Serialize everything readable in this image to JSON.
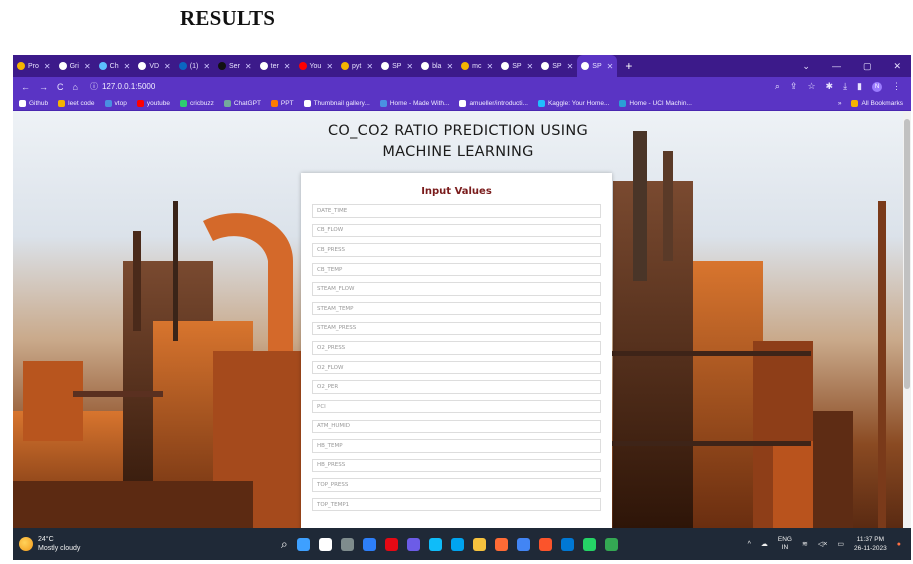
{
  "doc_heading": "RESULTS",
  "browser": {
    "tabs": [
      {
        "label": "Pro",
        "color": "#f5b400"
      },
      {
        "label": "Gri",
        "color": "#ffffff"
      },
      {
        "label": "Ch",
        "color": "#5cc0ff"
      },
      {
        "label": "VD",
        "color": "#ffffff"
      },
      {
        "label": "(1)",
        "color": "#0a66c2"
      },
      {
        "label": "Ser",
        "color": "#111111"
      },
      {
        "label": "ter",
        "color": "#ffffff"
      },
      {
        "label": "You",
        "color": "#ff0000"
      },
      {
        "label": "pyt",
        "color": "#f5b400"
      },
      {
        "label": "SP",
        "color": "#ffffff"
      },
      {
        "label": "bla",
        "color": "#ffffff"
      },
      {
        "label": "mc",
        "color": "#f5b400"
      },
      {
        "label": "SP",
        "color": "#ffffff"
      },
      {
        "label": "SP",
        "color": "#ffffff"
      },
      {
        "label": "SP",
        "color": "#ffffff",
        "active": true
      }
    ],
    "url": "127.0.0.1:5000",
    "bookmarks": [
      {
        "label": "Github",
        "color": "#ffffff"
      },
      {
        "label": "leet code",
        "color": "#f5b400"
      },
      {
        "label": "vtop",
        "color": "#4a90e2"
      },
      {
        "label": "youtube",
        "color": "#ff0000"
      },
      {
        "label": "cricbuzz",
        "color": "#2ecc71"
      },
      {
        "label": "ChatGPT",
        "color": "#74aa9c"
      },
      {
        "label": "PPT",
        "color": "#ff7b00"
      },
      {
        "label": "Thumbnail gallery...",
        "color": "#ffffff"
      },
      {
        "label": "Home - Made With...",
        "color": "#4a90e2"
      },
      {
        "label": "amueller/introducti...",
        "color": "#ffffff"
      },
      {
        "label": "Kaggle: Your Home...",
        "color": "#20beff"
      },
      {
        "label": "Home - UCI Machin...",
        "color": "#2a9fd6"
      }
    ],
    "bookmarks_right": "All Bookmarks"
  },
  "page": {
    "title_line1": "CO_CO2 RATIO PREDICTION USING",
    "title_line2": "MACHINE LEARNING",
    "form_title": "Input Values",
    "fields": [
      "DATE_TIME",
      "CB_FLOW",
      "CB_PRESS",
      "CB_TEMP",
      "STEAM_FLOW",
      "STEAM_TEMP",
      "STEAM_PRESS",
      "O2_PRESS",
      "O2_FLOW",
      "O2_PER",
      "PCI",
      "ATM_HUMID",
      "HB_TEMP",
      "HB_PRESS",
      "TOP_PRESS",
      "TOP_TEMP1"
    ]
  },
  "taskbar": {
    "temperature": "24°C",
    "weather": "Mostly cloudy",
    "apps": [
      "#3ea0ff",
      "#ffffff",
      "#7f8c8d",
      "#2d7ff9",
      "#e50914",
      "#6c5ce7",
      "#0fbcf9",
      "#00a4ef",
      "#f6c23e",
      "#ff6b35",
      "#4285f4",
      "#fb542b",
      "#0078d4",
      "#25d366",
      "#34a853"
    ],
    "lang_line1": "ENG",
    "lang_line2": "IN",
    "time": "11:37 PM",
    "date": "26-11-2023"
  }
}
